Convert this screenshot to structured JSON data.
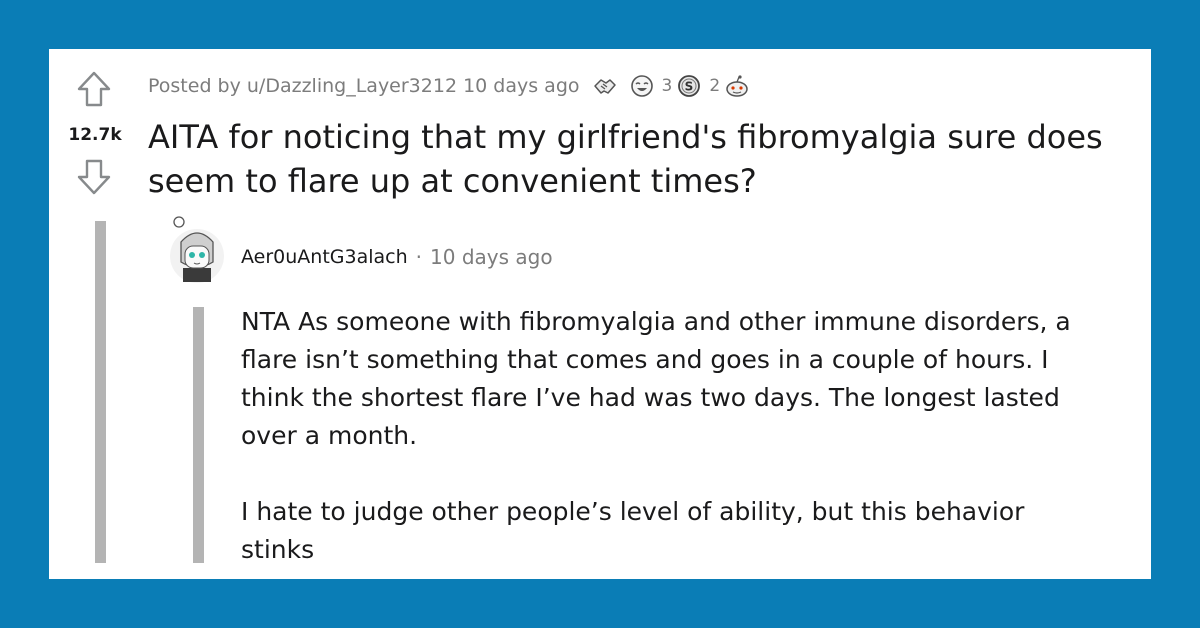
{
  "post": {
    "score": "12.7k",
    "posted_by": "Posted by u/Dazzling_Layer3212 10 days ago",
    "awards": [
      {
        "icon": "handshake-award-icon",
        "count": ""
      },
      {
        "icon": "laughing-face-award-icon",
        "count": "3"
      },
      {
        "icon": "silver-coin-award-icon",
        "count": "2"
      },
      {
        "icon": "wholesome-snoo-award-icon",
        "count": ""
      }
    ],
    "title": "AITA for noticing that my girlfriend's fibromyalgia sure does seem to flare up at convenient times?"
  },
  "comment": {
    "author": "Aer0uAntG3alach",
    "separator": "·",
    "time": "10 days ago",
    "paragraphs": [
      "NTA As someone with fibromyalgia and other immune disorders, a flare isn’t something that comes and goes in a couple of hours. I think the shortest flare I’ve had was two days. The longest lasted over a month.",
      "I hate to judge other people’s level of ability, but this behavior stinks"
    ]
  },
  "colors": {
    "frame": "#0a7db6",
    "card": "#ffffff",
    "thread_line": "#b4b4b4",
    "meta_text": "#7c7c7c",
    "body_text": "#1a1a1b"
  }
}
